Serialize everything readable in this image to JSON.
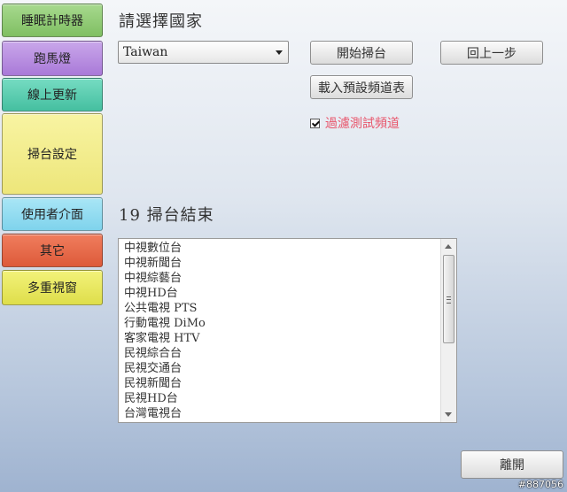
{
  "sidebar": {
    "items": [
      {
        "label": "睡眠計時器"
      },
      {
        "label": "跑馬燈"
      },
      {
        "label": "線上更新"
      },
      {
        "label": "掃台設定"
      },
      {
        "label": "使用者介面"
      },
      {
        "label": "其它"
      },
      {
        "label": "多重視窗"
      }
    ]
  },
  "main": {
    "country_title": "請選擇國家",
    "country_select": {
      "value": "Taiwan"
    },
    "start_scan_label": "開始掃台",
    "back_label": "回上一步",
    "load_default_label": "載入預設頻道表",
    "filter_test_channel": {
      "label": "過濾測試頻道",
      "checked": true
    },
    "scan_result": "19  掃台結束",
    "channels": [
      "中視數位台",
      "中視新聞台",
      "中視綜藝台",
      "中視HD台",
      "公共電視 PTS",
      "行動電視 DiMo",
      "客家電視 HTV",
      "民視綜合台",
      "民視交通台",
      "民視新聞台",
      "民視HD台",
      "台灣電視台"
    ],
    "exit_label": "離開"
  },
  "watermark": "#887056"
}
